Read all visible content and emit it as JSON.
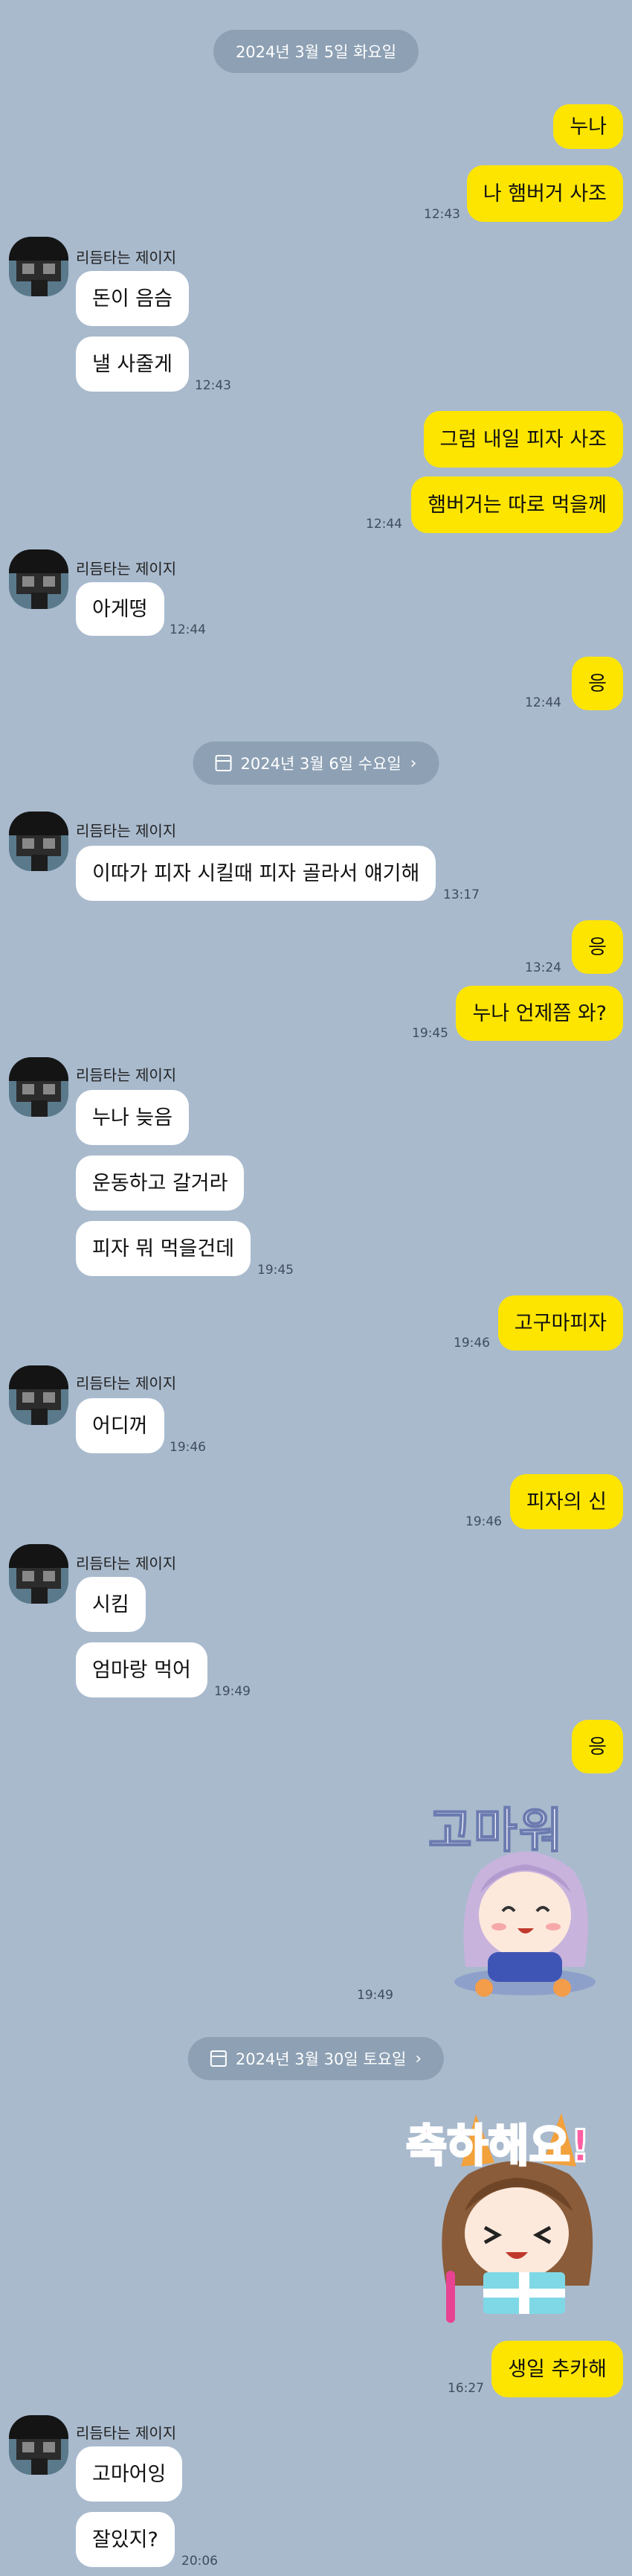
{
  "dates": {
    "d1": "2024년 3월 5일 화요일",
    "d2": "2024년 3월 6일 수요일",
    "d3": "2024년 3월 30일 토요일"
  },
  "sender_name": "리듬타는 제이지",
  "messages": {
    "m1": "누나",
    "m2": "나 햄버거 사조",
    "t2": "12:43",
    "m3": "돈이 음슴",
    "m4": "낼 사줄게",
    "t4": "12:43",
    "m5": "그럼 내일 피자 사조",
    "m6": "햄버거는 따로 먹을께",
    "t6": "12:44",
    "m7": "아게떵",
    "t7": "12:44",
    "m8": "응",
    "t8": "12:44",
    "m9": "이따가 피자 시킬때 피자 골라서 얘기해",
    "t9": "13:17",
    "m10": "응",
    "t10": "13:24",
    "m11": "누나 언제쯤 와?",
    "t11": "19:45",
    "m12": "누나 늦음",
    "m13": "운동하고 갈거라",
    "m14": "피자 뭐 먹을건데",
    "t14": "19:45",
    "m15": "고구마피자",
    "t15": "19:46",
    "m16": "어디꺼",
    "t16": "19:46",
    "m17": "피자의 신",
    "t17": "19:46",
    "m18": "시킴",
    "m19": "엄마랑 먹어",
    "t19": "19:49",
    "m20": "응",
    "sticker1_text": "고마워",
    "t20": "19:49",
    "sticker2_text": "축하해요!",
    "m21": "생일 추카해",
    "t21": "16:27",
    "m22": "고마어잉",
    "m23": "잘있지?",
    "t23": "20:06"
  },
  "colors": {
    "background": "#a9bacd",
    "my_bubble": "#fee500",
    "other_bubble": "#ffffff",
    "date_pill": "#8da0b4"
  },
  "icons": {
    "calendar": "calendar-icon",
    "chevron": "chevron-right-icon"
  }
}
